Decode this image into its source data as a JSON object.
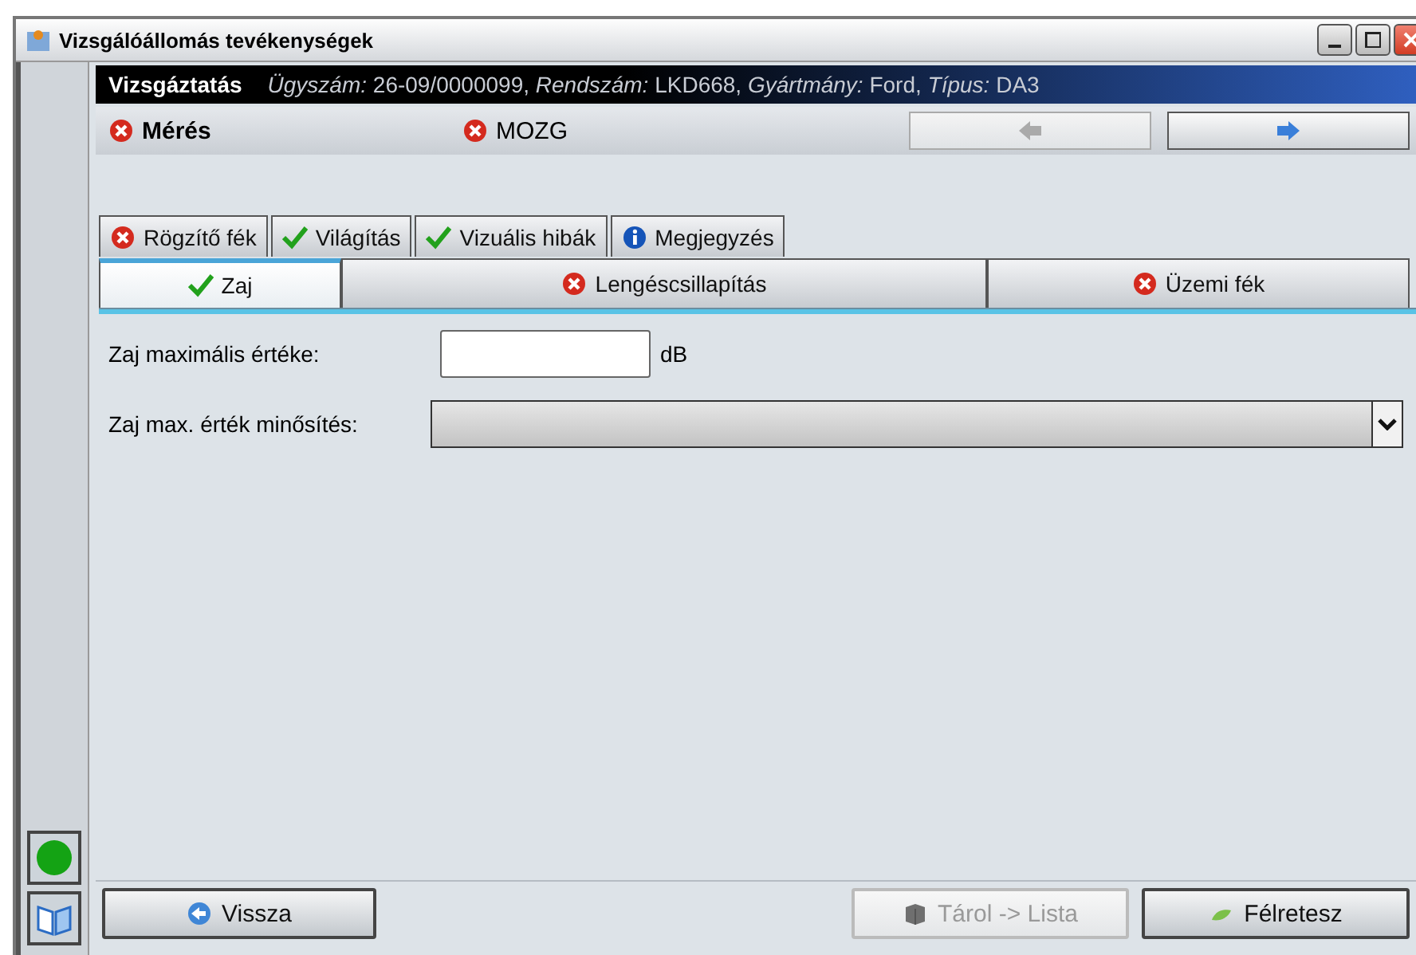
{
  "window": {
    "title": "Vizsgálóállomás tevékenységek"
  },
  "header": {
    "title": "Vizsgáztatás",
    "info": "*Ügyszám:* 26-09/0000099, *Rendszám:* LKD668, *Gyártmány:* Ford, *Típus:* DA3"
  },
  "status_items": [
    {
      "label": "Mérés",
      "kind": "error",
      "emphasis": true
    },
    {
      "label": "MOZG",
      "kind": "error",
      "emphasis": false
    }
  ],
  "nav_buttons": [
    {
      "kind": "back",
      "disabled": true
    },
    {
      "kind": "forward",
      "disabled": false
    }
  ],
  "tab_rows": [
    {
      "tabs": [
        {
          "label": "Rögzítő fék",
          "kind": "error",
          "selected": false
        },
        {
          "label": "Világítás",
          "kind": "ok",
          "selected": false
        },
        {
          "label": "Vizuális hibák",
          "kind": "ok",
          "selected": false
        },
        {
          "label": "Megjegyzés",
          "kind": "info",
          "selected": false
        }
      ]
    },
    {
      "tabs": [
        {
          "label": "Zaj",
          "kind": "ok",
          "selected": true
        },
        {
          "label": "Lengéscsillapítás",
          "kind": "error",
          "selected": false
        },
        {
          "label": "Üzemi fék",
          "kind": "error",
          "selected": false
        }
      ]
    }
  ],
  "fields": [
    {
      "kind": "text",
      "label": "Zaj maximális értéke:",
      "unit": "dB"
    },
    {
      "kind": "select",
      "label": "Zaj max. érték minősítés:"
    }
  ],
  "sidebar": {
    "indicator": {
      "kind": "ok"
    }
  },
  "footer_buttons": [
    {
      "label": "Vissza",
      "kind": "back",
      "disabled": false
    },
    {
      "label": "Tárol -> Lista",
      "kind": "store",
      "disabled": true
    },
    {
      "label": "Félretesz",
      "kind": "aside",
      "disabled": false
    }
  ]
}
